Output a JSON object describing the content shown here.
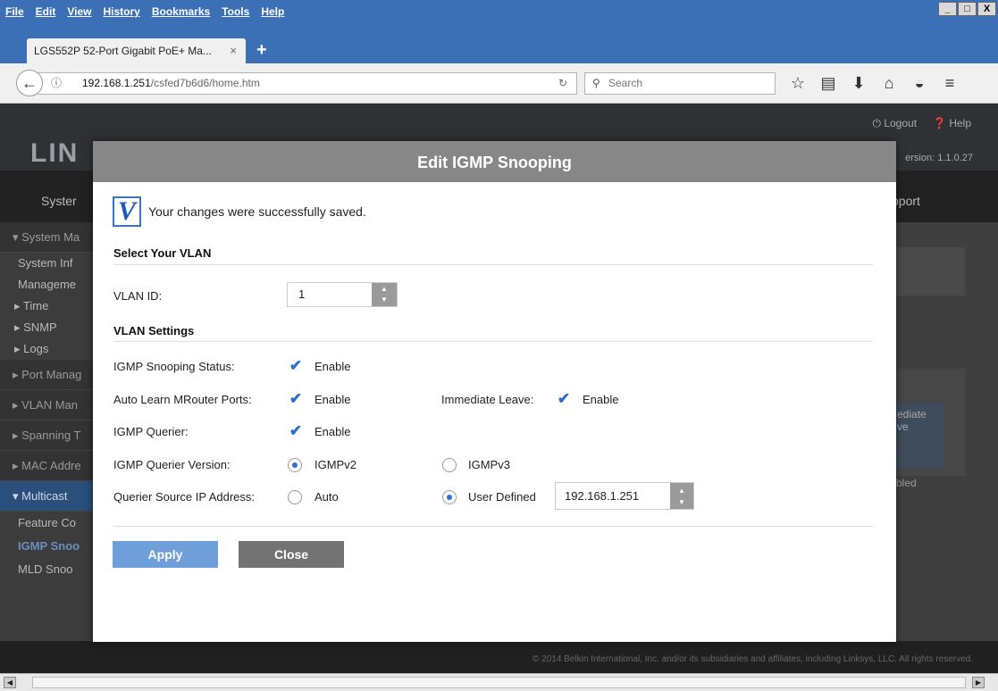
{
  "browser": {
    "menus": [
      "File",
      "Edit",
      "View",
      "History",
      "Bookmarks",
      "Tools",
      "Help"
    ],
    "window_controls": [
      "_",
      "□",
      "X"
    ],
    "tab_title": "LGS552P 52-Port Gigabit PoE+ Ma...",
    "tab_close": "×",
    "new_tab": "+",
    "url_host": "192.168.1.251",
    "url_path": "/csfed7b6d6/home.htm",
    "search_placeholder": "Search"
  },
  "page": {
    "logout": "Logout",
    "help": "Help",
    "logo": "LIN",
    "firmware": "ersion: 1.1.0.27",
    "nav_left": "Syster",
    "nav_right": "pport",
    "sidebar": {
      "system_management": "System Ma",
      "system_info": "System Inf",
      "management": "Manageme",
      "time": "Time",
      "snmp": "SNMP",
      "logs": "Logs",
      "port_management": "Port Manag",
      "vlan_management": "VLAN Man",
      "spanning_tree": "Spanning T",
      "mac_address": "MAC Addre",
      "multicast": "Multicast",
      "feature_config": "Feature Co",
      "igmp_snooping": "IGMP Snoo",
      "mld_snooping": "MLD Snoo"
    },
    "right_table_head_1": "ediate",
    "right_table_head_2": "ve",
    "right_table_cell": "bled",
    "footer": "© 2014 Belkin International, Inc. and/or its subsidiaries and affiliates, including Linksys, LLC. All rights reserved."
  },
  "modal": {
    "title": "Edit IGMP Snooping",
    "success_icon": "V",
    "success_message": "Your changes were successfully saved.",
    "select_vlan_heading": "Select Your VLAN",
    "vlan_id_label": "VLAN ID:",
    "vlan_id_value": "1",
    "vlan_settings_heading": "VLAN Settings",
    "snooping_status_label": "IGMP Snooping Status:",
    "auto_learn_label": "Auto Learn MRouter Ports:",
    "immediate_leave_label": "Immediate Leave:",
    "querier_label": "IGMP Querier:",
    "querier_version_label": "IGMP Querier Version:",
    "source_ip_label": "Querier Source IP Address:",
    "enable": "Enable",
    "igmpv2": "IGMPv2",
    "igmpv3": "IGMPv3",
    "auto": "Auto",
    "user_defined": "User Defined",
    "ip_value": "192.168.1.251",
    "apply": "Apply",
    "close": "Close",
    "checked": {
      "snooping_status": true,
      "auto_learn": true,
      "immediate_leave": true,
      "querier": true
    },
    "querier_version_selected": "IGMPv2",
    "source_ip_selected": "User Defined",
    "accent_color": "#2b6fcf"
  }
}
